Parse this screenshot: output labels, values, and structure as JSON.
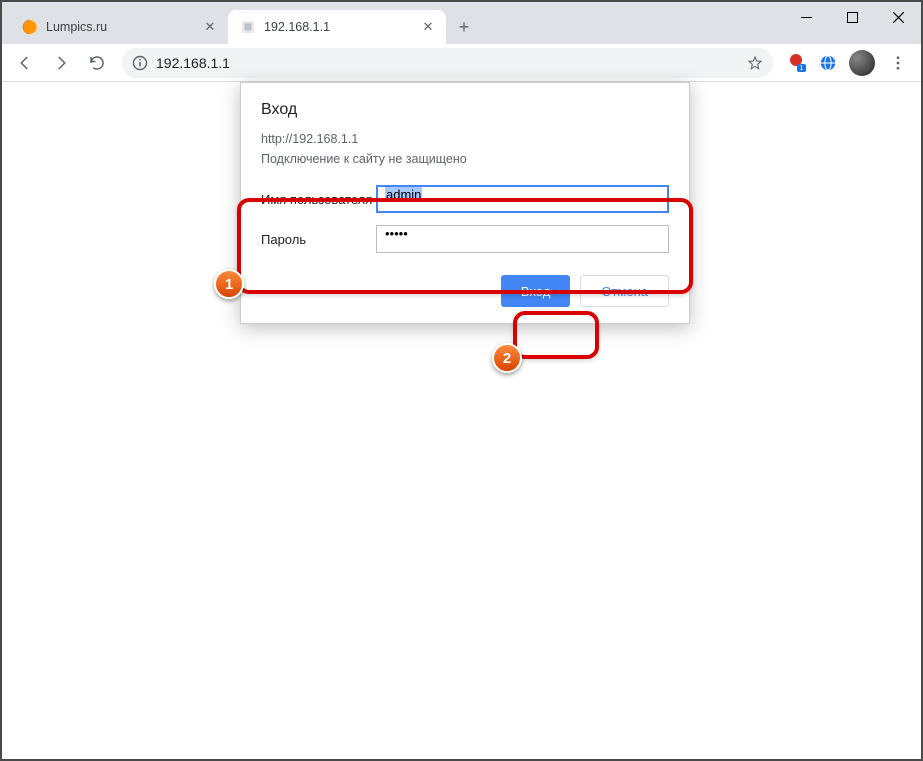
{
  "window": {
    "tabs": [
      {
        "title": "Lumpics.ru",
        "active": false
      },
      {
        "title": "192.168.1.1",
        "active": true
      }
    ]
  },
  "toolbar": {
    "url": "192.168.1.1"
  },
  "dialog": {
    "title": "Вход",
    "origin": "http://192.168.1.1",
    "warning": "Подключение к сайту не защищено",
    "username_label": "Имя пользователя",
    "username_value": "admin",
    "password_label": "Пароль",
    "password_value": "•••••",
    "submit_label": "Вход",
    "cancel_label": "Отмена"
  },
  "annotations": {
    "badge1": "1",
    "badge2": "2"
  }
}
